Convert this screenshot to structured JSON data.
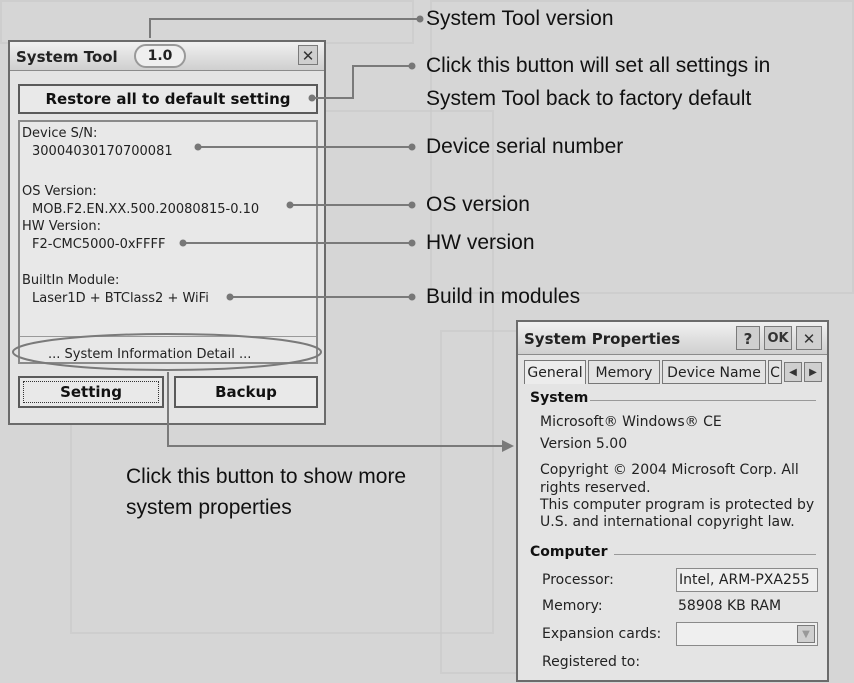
{
  "system_tool": {
    "title": "System Tool",
    "version": "1.0",
    "close_glyph": "✕",
    "restore_label": "Restore all to default setting",
    "fields": [
      {
        "label": "Device S/N:",
        "value": "30004030170700081"
      },
      {
        "label": "OS Version:",
        "value": "MOB.F2.EN.XX.500.20080815-0.10"
      },
      {
        "label": "HW Version:",
        "value": "F2-CMC5000-0xFFFF"
      },
      {
        "label": "BuiltIn Module:",
        "value": "Laser1D + BTClass2 + WiFi"
      }
    ],
    "detail_label": "... System Information Detail ...",
    "setting_label": "Setting",
    "backup_label": "Backup"
  },
  "callouts": {
    "version": "System Tool version",
    "restore_line1": "Click this button will set all settings in",
    "restore_line2": "System Tool back to factory default",
    "serial": "Device serial number",
    "os": "OS version",
    "hw": "HW version",
    "modules": "Build in modules",
    "detail_line1": "Click this button to show more",
    "detail_line2": "system properties"
  },
  "system_properties": {
    "title": "System Properties",
    "help_label": "?",
    "ok_label": "OK",
    "close_glyph": "✕",
    "tabs": [
      "General",
      "Memory",
      "Device Name",
      "C"
    ],
    "system_heading": "System",
    "os_name": "Microsoft® Windows® CE",
    "os_version": "Version 5.00",
    "copyright_lines": [
      "Copyright © 2004 Microsoft Corp. All",
      "rights reserved.",
      "This computer program is protected by",
      "U.S. and international copyright law."
    ],
    "computer_heading": "Computer",
    "processor_label": "Processor:",
    "processor_value": "Intel, ARM-PXA255",
    "memory_label": "Memory:",
    "memory_value": "58908 KB  RAM",
    "expansion_label": "Expansion cards:",
    "registered_label": "Registered to:"
  },
  "icons": [
    "close-icon",
    "scroll-left-icon",
    "scroll-right-icon",
    "dropdown-arrow-icon",
    "help-icon"
  ]
}
